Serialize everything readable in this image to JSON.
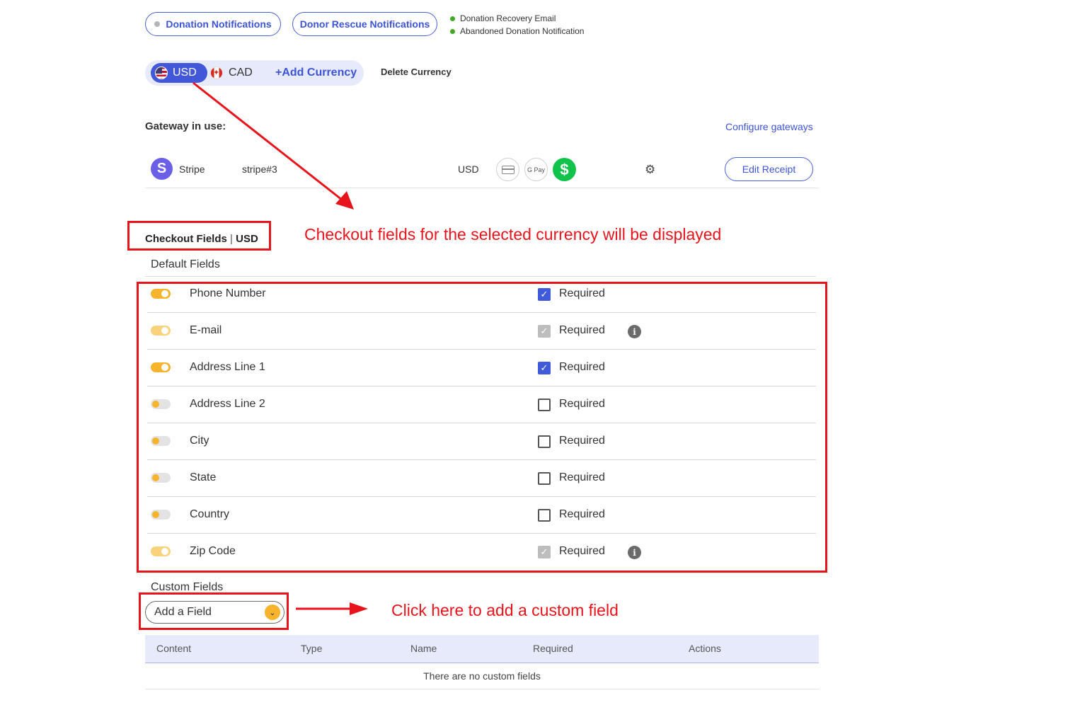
{
  "notifications": {
    "donation_btn": "Donation Notifications",
    "rescue_btn": "Donor Rescue Notifications",
    "status": [
      "Donation Recovery Email",
      "Abandoned Donation Notification"
    ]
  },
  "currency": {
    "selected": "USD",
    "other": "CAD",
    "add_label": "+Add Currency",
    "delete_label": "Delete Currency"
  },
  "gateway": {
    "title": "Gateway in use:",
    "configure_link": "Configure gateways",
    "name": "Stripe",
    "account": "stripe#3",
    "currency": "USD",
    "stripe_initial": "S",
    "gpay": "G Pay",
    "cash_symbol": "$",
    "edit_receipt": "Edit Receipt"
  },
  "checkout": {
    "title": "Checkout Fields",
    "separator": "|",
    "currency": "USD",
    "default_label": "Default Fields",
    "required_label": "Required",
    "fields": [
      {
        "label": "Phone Number",
        "toggle": "on",
        "required": "checked",
        "info": false
      },
      {
        "label": "E-mail",
        "toggle": "on-disabled",
        "required": "checked-disabled",
        "info": true
      },
      {
        "label": "Address Line 1",
        "toggle": "on",
        "required": "checked",
        "info": false
      },
      {
        "label": "Address Line 2",
        "toggle": "off",
        "required": "unchecked",
        "info": false
      },
      {
        "label": "City",
        "toggle": "off",
        "required": "unchecked",
        "info": false
      },
      {
        "label": "State",
        "toggle": "off",
        "required": "unchecked",
        "info": false
      },
      {
        "label": "Country",
        "toggle": "off",
        "required": "unchecked",
        "info": false
      },
      {
        "label": "Zip Code",
        "toggle": "on-disabled",
        "required": "checked-disabled",
        "info": true
      }
    ]
  },
  "custom_fields": {
    "label": "Custom Fields",
    "add_field": "Add a Field",
    "columns": [
      "Content",
      "Type",
      "Name",
      "Required",
      "Actions"
    ],
    "empty_message": "There are no custom fields"
  },
  "annotations": {
    "checkout_note": "Checkout fields for the selected currency will be displayed",
    "custom_note": "Click here to add a custom field",
    "color": "#e8141b"
  },
  "colors": {
    "accent": "#3d54d6",
    "toggle_on": "#f6b42d",
    "status_green": "#43a823",
    "cash_green": "#12c34b"
  }
}
